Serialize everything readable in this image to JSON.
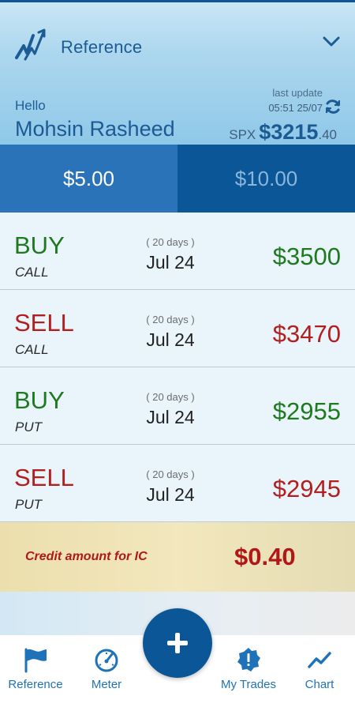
{
  "header": {
    "title": "Reference",
    "greeting": "Hello",
    "user_name": "Mohsin Rasheed",
    "last_update_label": "last update",
    "last_update_time": "05:51 25/07",
    "index_symbol": "SPX",
    "index_price_main": "$3215",
    "index_price_decimal": ".40"
  },
  "tabs": [
    {
      "label": "$5.00",
      "active": true
    },
    {
      "label": "$10.00",
      "active": false
    }
  ],
  "trades": [
    {
      "action": "BUY",
      "type": "CALL",
      "days": "( 20 days )",
      "date": "Jul 24",
      "strike": "$3500",
      "color": "#1e7a1e"
    },
    {
      "action": "SELL",
      "type": "CALL",
      "days": "( 20 days )",
      "date": "Jul 24",
      "strike": "$3470",
      "color": "#b31e1e"
    },
    {
      "action": "BUY",
      "type": "PUT",
      "days": "( 20 days )",
      "date": "Jul 24",
      "strike": "$2955",
      "color": "#1e7a1e"
    },
    {
      "action": "SELL",
      "type": "PUT",
      "days": "( 20 days )",
      "date": "Jul 24",
      "strike": "$2945",
      "color": "#b31e1e"
    }
  ],
  "credit": {
    "label": "Credit amount for IC",
    "value": "$0.40"
  },
  "nav": [
    {
      "label": "Reference",
      "icon": "flag-icon"
    },
    {
      "label": "Meter",
      "icon": "speedometer-icon"
    },
    {
      "label": "My Trades",
      "icon": "badge-alert-icon"
    },
    {
      "label": "Chart",
      "icon": "line-chart-icon"
    }
  ],
  "fab": {
    "icon": "plus-icon"
  },
  "colors": {
    "primary": "#0b5697",
    "accent": "#1e73b8",
    "buy": "#1e7a1e",
    "sell": "#b31e1e"
  }
}
